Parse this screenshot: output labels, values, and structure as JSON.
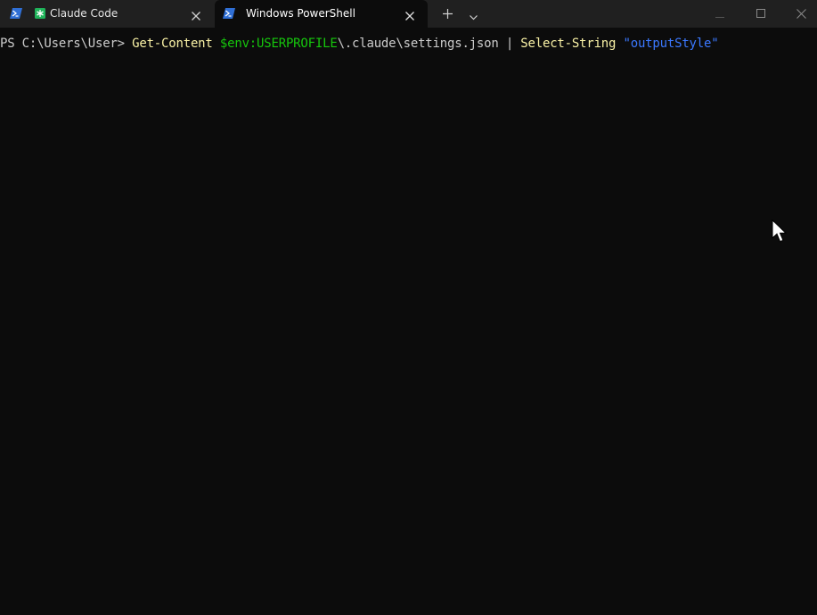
{
  "tabs": [
    {
      "label": "Claude Code",
      "active": false,
      "icon": "powershell-icon",
      "secondary_icon": "claude-asterisk-icon"
    },
    {
      "label": "Windows PowerShell",
      "active": true,
      "icon": "powershell-icon"
    }
  ],
  "colors": {
    "titlebar": "#202020",
    "terminal_bg": "#0c0c0c",
    "prompt": "#cccccc",
    "cmdlet": "#f9f1a5",
    "variable": "#16c60c",
    "string": "#3b78ff",
    "powershell_icon": "#2f6fd6",
    "claude_icon": "#1fb35a"
  },
  "terminal": {
    "prompt": "PS C:\\Users\\User> ",
    "cmd1": "Get-Content",
    "sp1": " ",
    "var": "$env:USERPROFILE",
    "path": "\\.claude\\settings.json | ",
    "cmd2": "Select-String",
    "sp2": " ",
    "str": "\"outputStyle\""
  }
}
